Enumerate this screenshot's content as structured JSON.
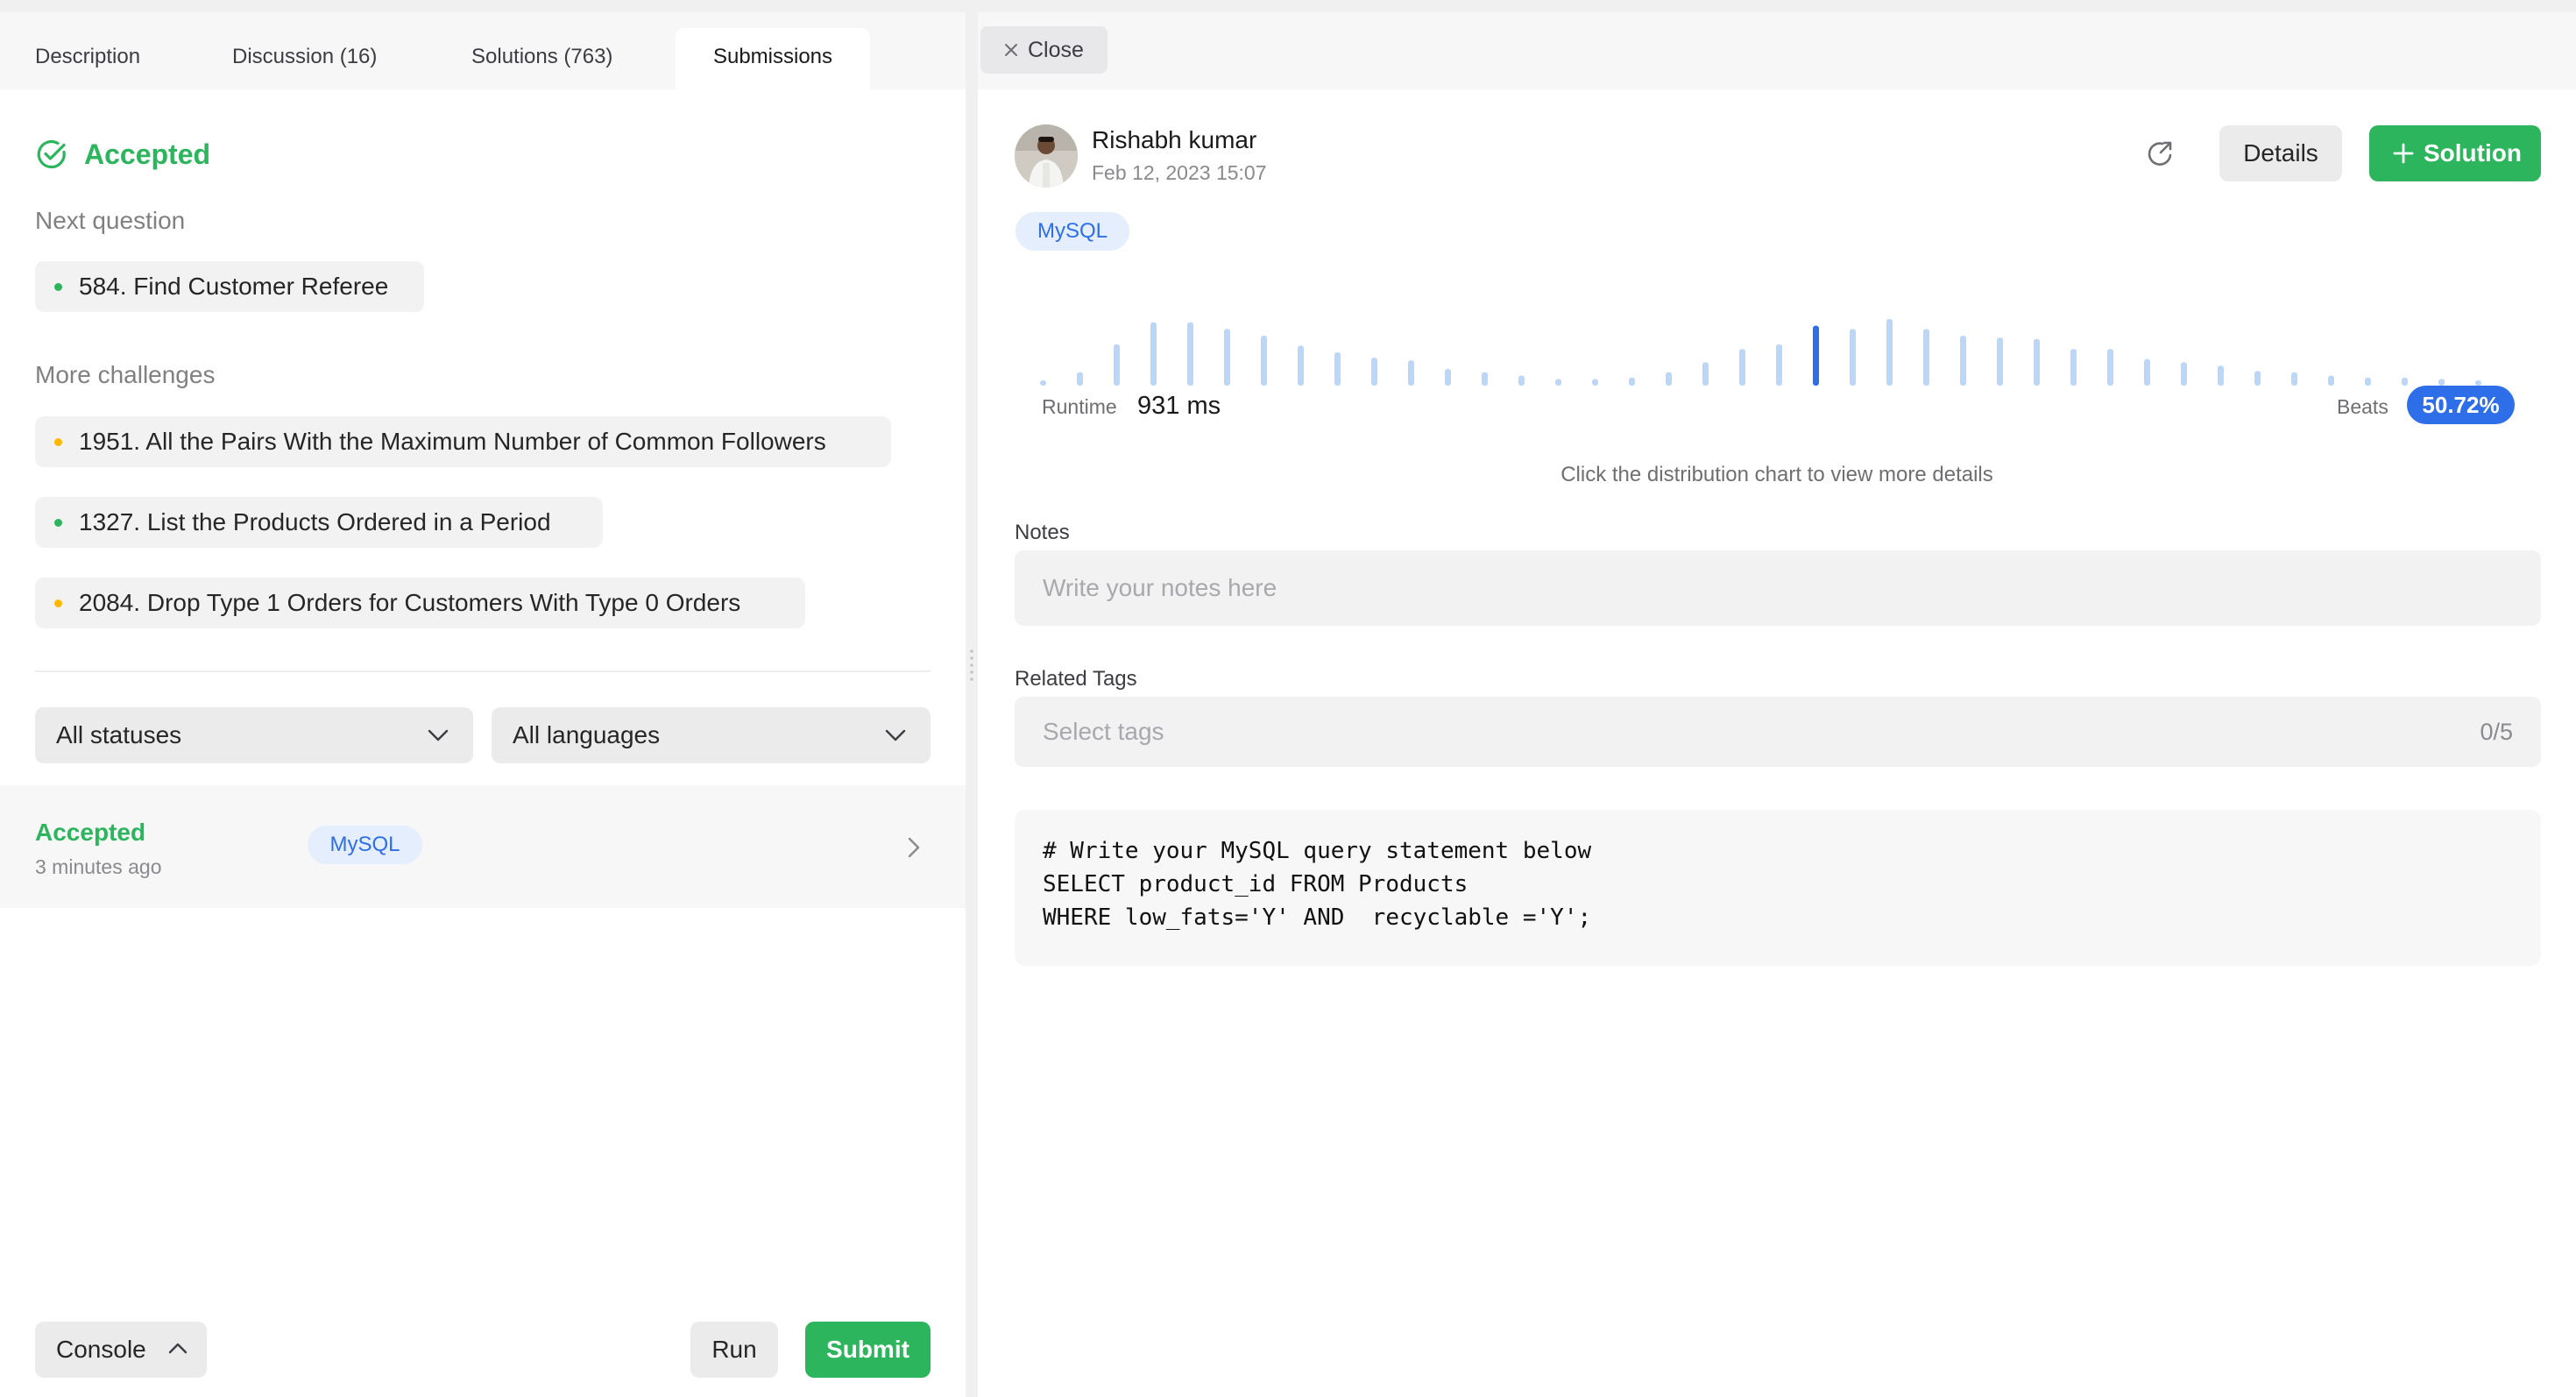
{
  "tabs": {
    "description": "Description",
    "discussion": "Discussion (16)",
    "solutions": "Solutions (763)",
    "submissions": "Submissions"
  },
  "result": {
    "status": "Accepted",
    "status_color": "#2db55d",
    "icon": "check-circle-icon"
  },
  "next_question": {
    "label": "Next question",
    "items": [
      {
        "title": "584. Find Customer Referee",
        "difficulty_color": "#2db55d"
      }
    ]
  },
  "more_challenges": {
    "label": "More challenges",
    "items": [
      {
        "title": "1951. All the Pairs With the Maximum Number of Common Followers",
        "difficulty_color": "#ffb800"
      },
      {
        "title": "1327. List the Products Ordered in a Period",
        "difficulty_color": "#2db55d"
      },
      {
        "title": "2084. Drop Type 1 Orders for Customers With Type 0 Orders",
        "difficulty_color": "#ffb800"
      }
    ]
  },
  "filters": {
    "status": "All statuses",
    "language": "All languages"
  },
  "submission_row": {
    "status": "Accepted",
    "time": "3 minutes ago",
    "language": "MySQL"
  },
  "footer": {
    "console": "Console",
    "run": "Run",
    "submit": "Submit"
  },
  "panel": {
    "close": "Close"
  },
  "author": {
    "name": "Rishabh kumar",
    "date": "Feb 12, 2023 15:07"
  },
  "actions": {
    "details": "Details",
    "solution": "Solution"
  },
  "language_tag": "MySQL",
  "runtime": {
    "label": "Runtime",
    "value": "931 ms",
    "beats_label": "Beats",
    "beats_value": "50.72%"
  },
  "distribution": {
    "bar_levels": [
      0.05,
      0.2,
      0.62,
      0.95,
      0.95,
      0.85,
      0.75,
      0.6,
      0.5,
      0.42,
      0.38,
      0.25,
      0.2,
      0.15,
      0.1,
      0.1,
      0.12,
      0.2,
      0.35,
      0.55,
      0.62,
      0.9,
      0.85,
      1.0,
      0.85,
      0.75,
      0.72,
      0.7,
      0.55,
      0.55,
      0.4,
      0.35,
      0.3,
      0.22,
      0.2,
      0.15,
      0.12,
      0.12,
      0.1,
      0.08
    ],
    "highlight_index": 21,
    "bar_color": "#bcd6f8",
    "highlight_color": "#2e6ee8",
    "hint": "Click the distribution chart to view more details"
  },
  "notes": {
    "label": "Notes",
    "placeholder": "Write your notes here"
  },
  "related_tags": {
    "label": "Related Tags",
    "placeholder": "Select tags",
    "count": "0/5"
  },
  "code": {
    "lines": [
      "# Write your MySQL query statement below",
      "SELECT product_id FROM Products",
      "WHERE low_fats='Y' AND  recyclable ='Y';"
    ]
  }
}
